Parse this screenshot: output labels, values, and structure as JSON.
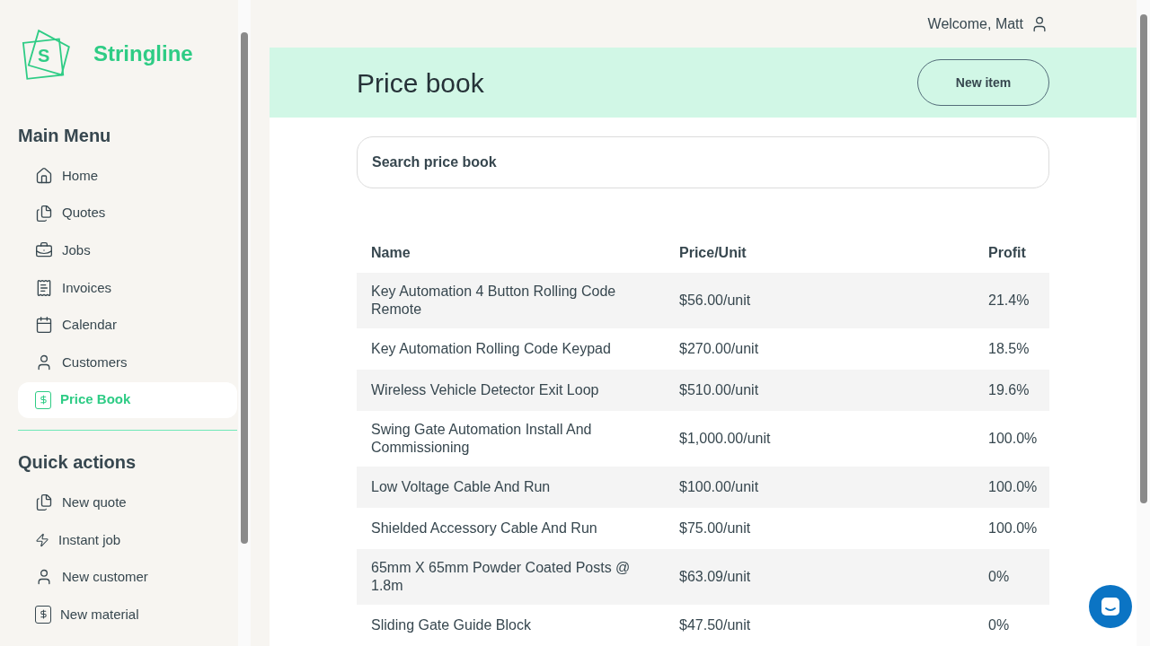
{
  "brand": {
    "name": "Stringline",
    "logo_letter": "S"
  },
  "sidebar": {
    "sections": [
      {
        "title": "Main Menu",
        "items": [
          {
            "label": "Home",
            "kind": "home",
            "selected": false
          },
          {
            "label": "Quotes",
            "kind": "files",
            "selected": false
          },
          {
            "label": "Jobs",
            "kind": "briefcase",
            "selected": false
          },
          {
            "label": "Invoices",
            "kind": "receipt",
            "selected": false
          },
          {
            "label": "Calendar",
            "kind": "calendar",
            "selected": false
          },
          {
            "label": "Customers",
            "kind": "user",
            "selected": false
          },
          {
            "label": "Price Book",
            "kind": "dollar",
            "selected": true
          }
        ]
      },
      {
        "title": "Quick actions",
        "items": [
          {
            "label": "New quote",
            "kind": "files",
            "selected": false
          },
          {
            "label": "Instant job",
            "kind": "bolt",
            "selected": false
          },
          {
            "label": "New customer",
            "kind": "user",
            "selected": false
          },
          {
            "label": "New material",
            "kind": "dollar",
            "selected": false
          }
        ]
      }
    ]
  },
  "top_bar": {
    "welcome": "Welcome, Matt"
  },
  "page": {
    "title": "Price book",
    "new_button": "New item",
    "search": {
      "placeholder": "Search price book"
    }
  },
  "table": {
    "columns": [
      "Name",
      "Price/Unit",
      "Profit"
    ],
    "rows": [
      [
        "Key Automation 4 Button Rolling Code Remote",
        "$56.00/unit",
        "21.4%"
      ],
      [
        "Key Automation Rolling Code Keypad",
        "$270.00/unit",
        "18.5%"
      ],
      [
        "Wireless Vehicle Detector Exit Loop",
        "$510.00/unit",
        "19.6%"
      ],
      [
        "Swing Gate Automation Install And Commissioning",
        "$1,000.00/unit",
        "100.0%"
      ],
      [
        "Low Voltage Cable And Run",
        "$100.00/unit",
        "100.0%"
      ],
      [
        "Shielded Accessory Cable And Run",
        "$75.00/unit",
        "100.0%"
      ],
      [
        "65mm X 65mm Powder Coated Posts @ 1.8m",
        "$63.09/unit",
        "0%"
      ],
      [
        "Sliding Gate Guide Block",
        "$47.50/unit",
        "0%"
      ]
    ]
  }
}
